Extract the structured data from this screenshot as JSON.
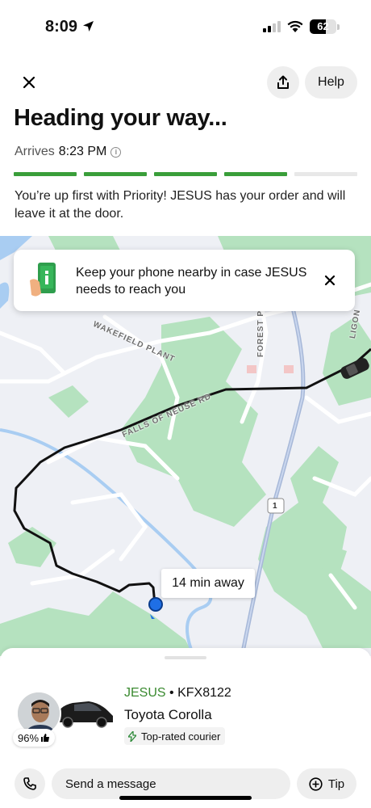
{
  "status_bar": {
    "time": "8:09",
    "battery": "62",
    "battery_level": 0.62
  },
  "header": {
    "help_label": "Help"
  },
  "title": "Heading your way...",
  "arrival": {
    "label": "Arrives",
    "time": "8:23 PM"
  },
  "progress": {
    "total_steps": 5,
    "completed_steps": 4
  },
  "order_message": "You’re up first with Priority! JESUS has your order and will leave it at the door.",
  "map": {
    "notice_text": "Keep your phone nearby in case JESUS needs to reach you",
    "eta": "14 min away",
    "streets": {
      "wakefield": "WAKEFIELD PLANT",
      "falls": "FALLS OF NEUSE RD",
      "forest": "FOREST P",
      "route_shield": "1",
      "ligon": "LIGON"
    }
  },
  "courier": {
    "name": "JESUS",
    "separator": "•",
    "plate": "KFX8122",
    "vehicle": "Toyota Corolla",
    "rating": "96%",
    "badge": "Top-rated courier"
  },
  "actions": {
    "message_label": "Send a message",
    "tip_label": "Tip"
  },
  "colors": {
    "accent_green": "#3a9e3a",
    "route": "#111111",
    "courier_dot": "#1f6fe5"
  }
}
